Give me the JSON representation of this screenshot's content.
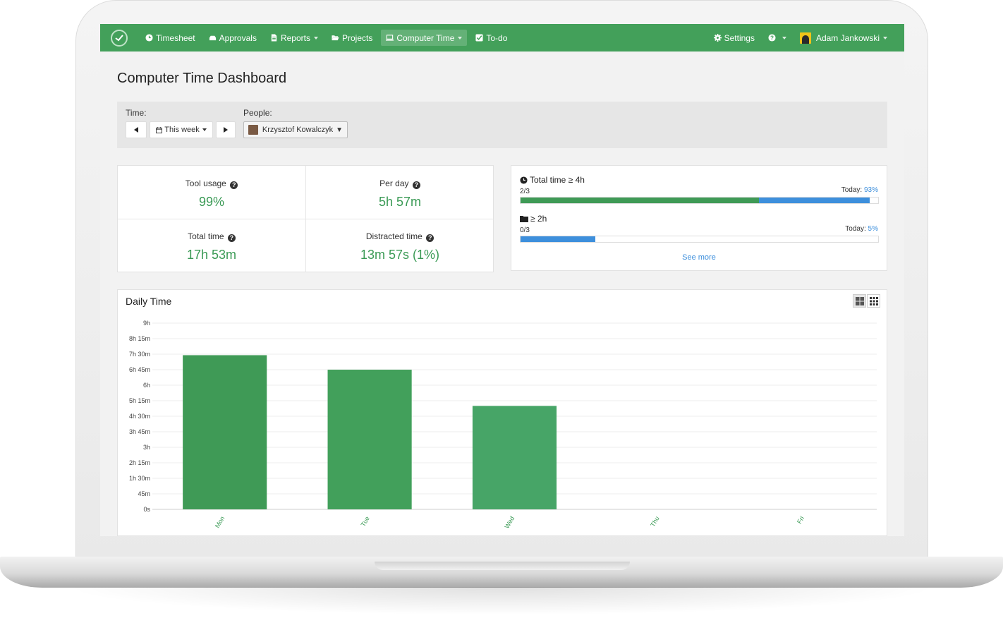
{
  "nav": {
    "items": [
      {
        "label": "Timesheet",
        "icon": "clock-icon",
        "active": false,
        "dropdown": false
      },
      {
        "label": "Approvals",
        "icon": "thumbs-up-icon",
        "active": false,
        "dropdown": false
      },
      {
        "label": "Reports",
        "icon": "document-icon",
        "active": false,
        "dropdown": true
      },
      {
        "label": "Projects",
        "icon": "folder-open-icon",
        "active": false,
        "dropdown": false
      },
      {
        "label": "Computer Time",
        "icon": "laptop-icon",
        "active": true,
        "dropdown": true
      },
      {
        "label": "To-do",
        "icon": "checkbox-icon",
        "active": false,
        "dropdown": false
      }
    ],
    "settings_label": "Settings",
    "user_name": "Adam Jankowski"
  },
  "page": {
    "title": "Computer Time Dashboard"
  },
  "filters": {
    "time_label": "Time:",
    "period_label": "This week",
    "people_label": "People:",
    "person_name": "Krzysztof Kowalczyk"
  },
  "stats": {
    "tool_usage": {
      "label": "Tool usage",
      "value": "99%"
    },
    "per_day": {
      "label": "Per day",
      "value": "5h 57m"
    },
    "total_time": {
      "label": "Total time",
      "value": "17h 53m"
    },
    "distracted_time": {
      "label": "Distracted time",
      "value": "13m 57s (1%)"
    }
  },
  "goals": {
    "items": [
      {
        "title": "Total time ≥ 4h",
        "icon": "clock-icon",
        "count": "2/3",
        "today_label": "Today:",
        "today_pct": "93%",
        "done_fraction": 0.667,
        "today_fraction": 0.31
      },
      {
        "title": "≥ 2h",
        "icon": "folder-icon",
        "count": "0/3",
        "today_label": "Today:",
        "today_pct": "5%",
        "done_fraction": 0,
        "today_fraction": 0.21
      }
    ],
    "see_more": "See more"
  },
  "chart_data": {
    "type": "bar",
    "title": "Daily Time",
    "categories": [
      "Mon",
      "Tue",
      "Wed",
      "Thu",
      "Fri"
    ],
    "values_minutes": [
      447,
      405,
      300,
      0,
      0
    ],
    "y_ticks": [
      "0s",
      "45m",
      "1h 30m",
      "2h 15m",
      "3h",
      "3h 45m",
      "4h 30m",
      "5h 15m",
      "6h",
      "6h 45m",
      "7h 30m",
      "8h 15m",
      "9h"
    ],
    "ylim_minutes": [
      0,
      540
    ],
    "grid": true,
    "bar_colors": [
      "#3f9a56",
      "#42a05b",
      "#47a567",
      "#3f9a56",
      "#3f9a56"
    ]
  },
  "colors": {
    "nav": "#43a05a",
    "accent_green": "#3a9a55",
    "accent_blue": "#3d8fdc"
  }
}
